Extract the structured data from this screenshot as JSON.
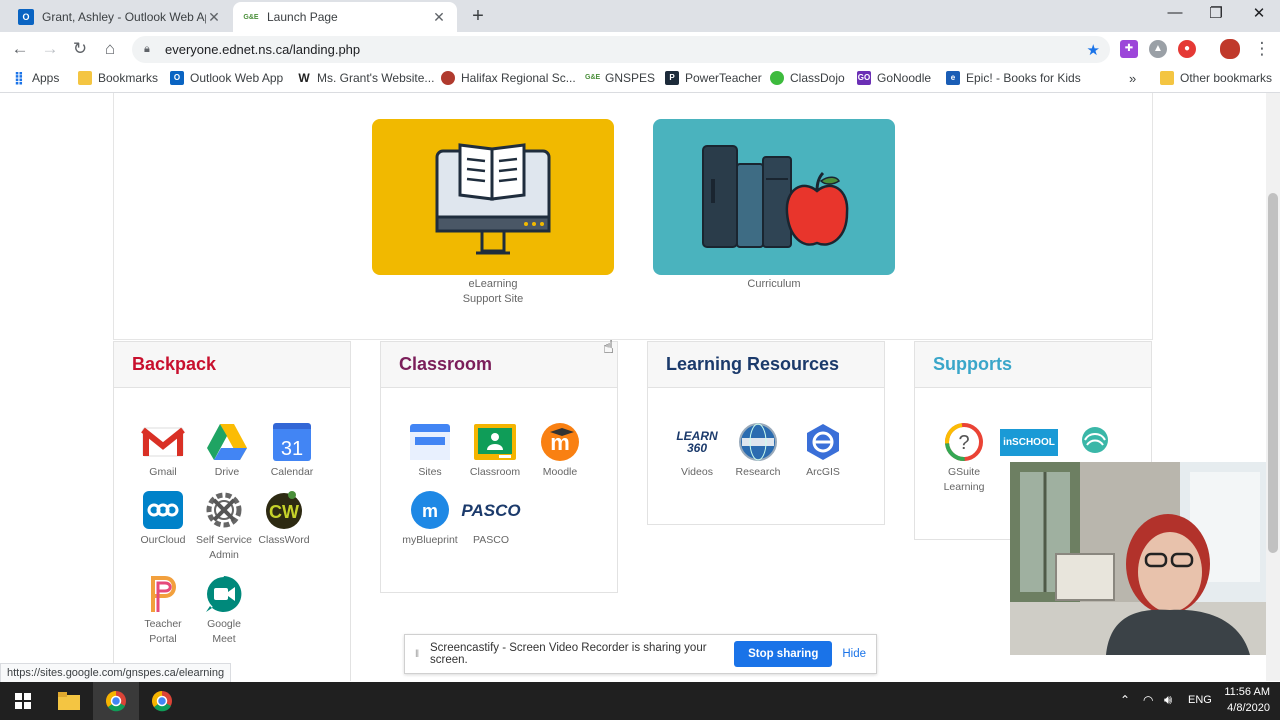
{
  "browser": {
    "tabs": [
      {
        "title": "Grant, Ashley - Outlook Web App",
        "active": false,
        "favicon": "outlook-icon"
      },
      {
        "title": "Launch Page",
        "active": true,
        "favicon": "gnspes-icon"
      }
    ],
    "url": "everyone.ednet.ns.ca/landing.php",
    "bookmarks": [
      {
        "label": "Apps",
        "icon": "apps-grid-icon"
      },
      {
        "label": "Bookmarks",
        "icon": "folder-icon"
      },
      {
        "label": "Outlook Web App",
        "icon": "outlook-icon"
      },
      {
        "label": "Ms. Grant's Website...",
        "icon": "wix-icon"
      },
      {
        "label": "Halifax Regional Sc...",
        "icon": "hrce-icon"
      },
      {
        "label": "GNSPES",
        "icon": "gnspes-icon"
      },
      {
        "label": "PowerTeacher",
        "icon": "powerteacher-icon"
      },
      {
        "label": "ClassDojo",
        "icon": "classdojo-icon"
      },
      {
        "label": "GoNoodle",
        "icon": "gonoodle-icon"
      },
      {
        "label": "Epic! - Books for Kids",
        "icon": "epic-icon"
      }
    ],
    "other_bookmarks": "Other bookmarks",
    "status_url": "https://sites.google.com/gnspes.ca/elearning"
  },
  "tiles": [
    {
      "line1": "eLearning",
      "line2": "Support Site"
    },
    {
      "line1": "Curriculum",
      "line2": ""
    }
  ],
  "panels": {
    "backpack": {
      "title": "Backpack",
      "color": "#c8102e",
      "apps": [
        {
          "label": "Gmail",
          "label2": ""
        },
        {
          "label": "Drive",
          "label2": ""
        },
        {
          "label": "Calendar",
          "label2": "",
          "badge": "31"
        },
        {
          "label": "OurCloud",
          "label2": ""
        },
        {
          "label": "Self Service",
          "label2": "Admin"
        },
        {
          "label": "ClassWord",
          "label2": ""
        },
        {
          "label": "Teacher",
          "label2": "Portal"
        },
        {
          "label": "Google",
          "label2": "Meet"
        }
      ]
    },
    "classroom": {
      "title": "Classroom",
      "color": "#7b1e5a",
      "apps": [
        {
          "label": "Sites",
          "label2": ""
        },
        {
          "label": "Classroom",
          "label2": ""
        },
        {
          "label": "Moodle",
          "label2": ""
        },
        {
          "label": "myBlueprint",
          "label2": ""
        },
        {
          "label": "PASCO",
          "label2": "",
          "logo_text": "PASCO"
        }
      ]
    },
    "learning": {
      "title": "Learning Resources",
      "color": "#1b3a6b",
      "apps": [
        {
          "label": "Videos",
          "label2": "",
          "logo_text": "LEARN 360"
        },
        {
          "label": "Research",
          "label2": ""
        },
        {
          "label": "ArcGIS",
          "label2": ""
        }
      ]
    },
    "supports": {
      "title": "Supports",
      "color": "#3aa6c9",
      "apps": [
        {
          "label": "GSuite",
          "label2": "Learning"
        },
        {
          "label": "",
          "label2": "",
          "logo_text": "inSCHOOL"
        },
        {
          "label": "",
          "label2": ""
        }
      ]
    }
  },
  "screencastify": {
    "message": "Screencastify - Screen Video Recorder is sharing your screen.",
    "stop": "Stop sharing",
    "hide": "Hide"
  },
  "taskbar": {
    "language": "ENG",
    "time": "11:56 AM",
    "date": "4/8/2020"
  }
}
